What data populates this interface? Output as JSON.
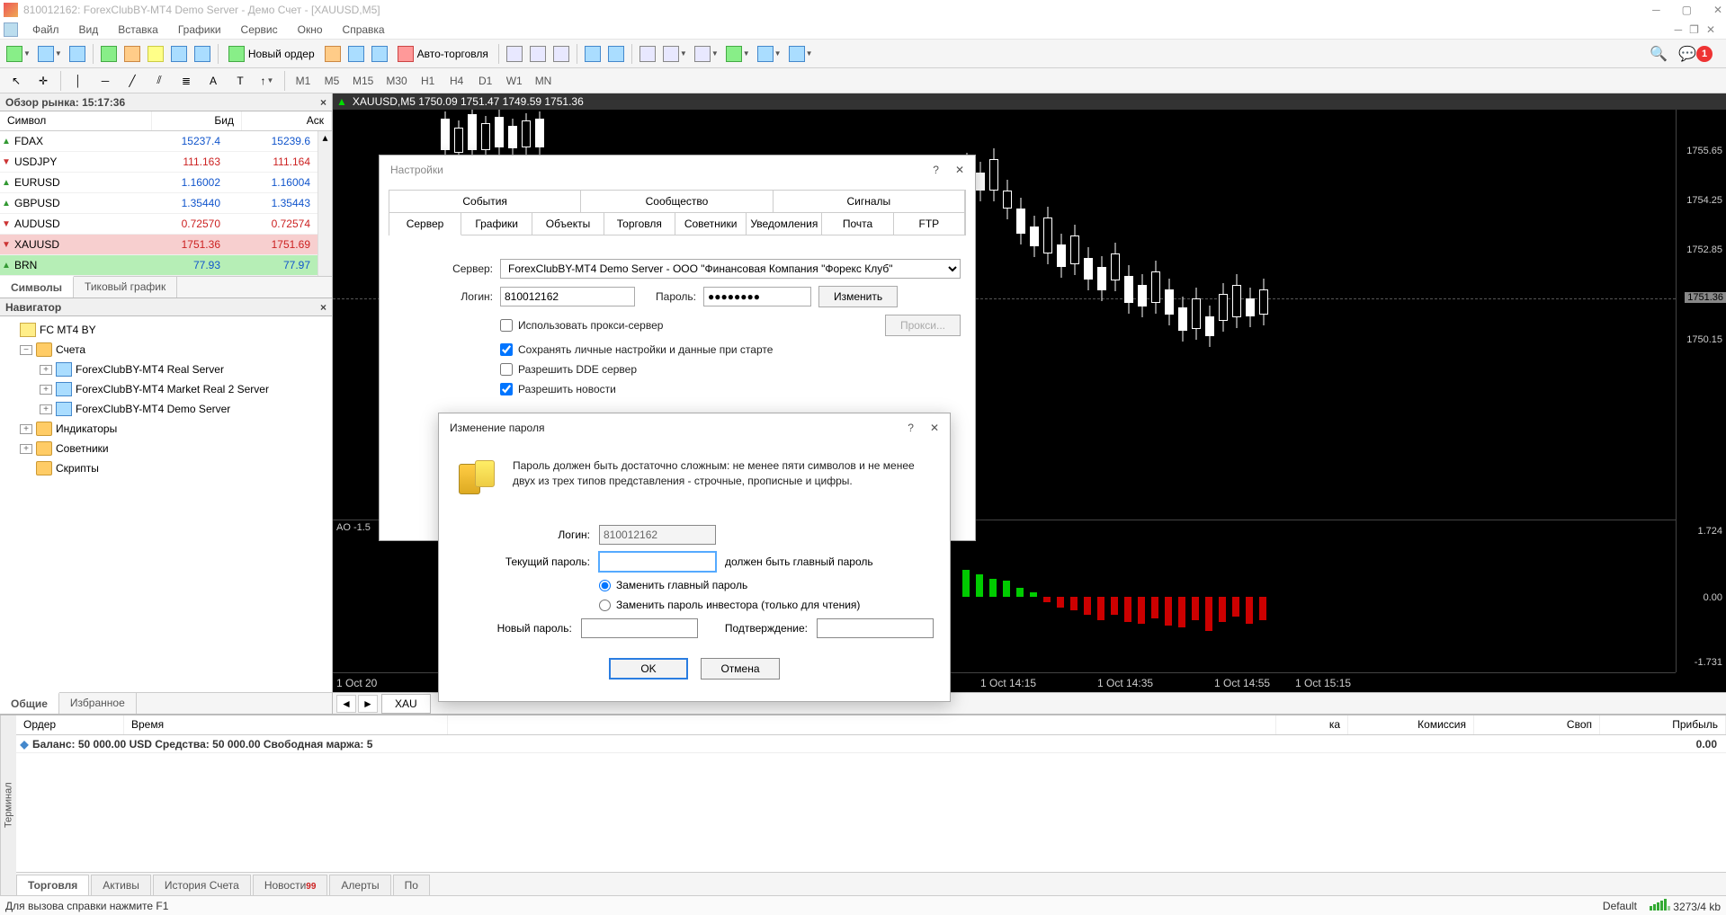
{
  "window": {
    "title": "810012162: ForexClubBY-MT4 Demo Server - Демо Счет - [XAUUSD,M5]"
  },
  "menu": [
    "Файл",
    "Вид",
    "Вставка",
    "Графики",
    "Сервис",
    "Окно",
    "Справка"
  ],
  "toolbar1": {
    "new_order": "Новый ордер",
    "auto_trade": "Авто-торговля",
    "notif_count": "1"
  },
  "timeframes": [
    "M1",
    "M5",
    "M15",
    "M30",
    "H1",
    "H4",
    "D1",
    "W1",
    "MN"
  ],
  "market_watch": {
    "title": "Обзор рынка: 15:17:36",
    "cols": {
      "symbol": "Символ",
      "bid": "Бид",
      "ask": "Аск"
    },
    "rows": [
      {
        "dir": "up",
        "sym": "FDAX",
        "bid": "15237.4",
        "ask": "15239.6",
        "cls": "blue"
      },
      {
        "dir": "down",
        "sym": "USDJPY",
        "bid": "111.163",
        "ask": "111.164",
        "cls": "red"
      },
      {
        "dir": "up",
        "sym": "EURUSD",
        "bid": "1.16002",
        "ask": "1.16004",
        "cls": "blue"
      },
      {
        "dir": "up",
        "sym": "GBPUSD",
        "bid": "1.35440",
        "ask": "1.35443",
        "cls": "blue"
      },
      {
        "dir": "down",
        "sym": "AUDUSD",
        "bid": "0.72570",
        "ask": "0.72574",
        "cls": "red"
      },
      {
        "dir": "down",
        "sym": "XAUUSD",
        "bid": "1751.36",
        "ask": "1751.69",
        "cls": "red",
        "hl": "hl-red"
      },
      {
        "dir": "up",
        "sym": "BRN",
        "bid": "77.93",
        "ask": "77.97",
        "cls": "blue",
        "hl": "hl-green"
      }
    ],
    "tabs": {
      "symbols": "Символы",
      "tick": "Тиковый график"
    }
  },
  "navigator": {
    "title": "Навигатор",
    "root": "FC MT4 BY",
    "accounts": "Счета",
    "servers": [
      "ForexClubBY-MT4 Real Server",
      "ForexClubBY-MT4 Market Real 2 Server",
      "ForexClubBY-MT4 Demo Server"
    ],
    "nodes": [
      "Индикаторы",
      "Советники",
      "Скрипты"
    ],
    "tabs": {
      "common": "Общие",
      "fav": "Избранное"
    }
  },
  "chart": {
    "header": "XAUUSD,M5  1750.09 1751.47 1749.59 1751.36",
    "y_ticks": [
      "1755.65",
      "1754.25",
      "1752.85",
      "1751.36",
      "1750.15"
    ],
    "price_tag": "1751.36",
    "ind_label": "AO -1.5",
    "ind_y": [
      "1.724",
      "0.00",
      "-1.731"
    ],
    "x_ticks": [
      "1 Oct 20",
      "1 Oct 14:15",
      "1 Oct 14:35",
      "1 Oct 14:55",
      "1 Oct 15:15"
    ],
    "tab": "XAU"
  },
  "terminal": {
    "handle": "Терминал",
    "cols": [
      "Ордер",
      "Время",
      "ка",
      "Комиссия",
      "Своп",
      "Прибыль"
    ],
    "balance_line": "Баланс: 50 000.00 USD  Средства: 50 000.00  Свободная маржа: 5",
    "profit": "0.00",
    "tabs": [
      "Торговля",
      "Активы",
      "История Счета",
      "Новости",
      "Алерты",
      "По"
    ],
    "news_badge": "99"
  },
  "statusbar": {
    "help": "Для вызова справки нажмите F1",
    "profile": "Default",
    "conn": "3273/4 kb"
  },
  "dlg_settings": {
    "title": "Настройки",
    "tabs_top": [
      "События",
      "Сообщество",
      "Сигналы"
    ],
    "tabs_bottom": [
      "Сервер",
      "Графики",
      "Объекты",
      "Торговля",
      "Советники",
      "Уведомления",
      "Почта",
      "FTP"
    ],
    "server_label": "Сервер:",
    "server_value": "ForexClubBY-MT4 Demo Server - ООО \"Финансовая Компания \"Форекс Клуб\"",
    "login_label": "Логин:",
    "login_value": "810012162",
    "password_label": "Пароль:",
    "password_mask": "●●●●●●●●",
    "change_btn": "Изменить",
    "proxy_chk": "Использовать прокси-сервер",
    "proxy_btn": "Прокси...",
    "keep_chk": "Сохранять личные настройки и данные при старте",
    "dde_chk": "Разрешить DDE сервер",
    "news_chk": "Разрешить новости"
  },
  "dlg_pwd": {
    "title": "Изменение пароля",
    "info": "Пароль должен быть достаточно сложным: не менее пяти символов и не менее двух из трех типов представления - строчные, прописные и цифры.",
    "login_label": "Логин:",
    "login_value": "810012162",
    "cur_label": "Текущий пароль:",
    "cur_hint": "должен быть главный пароль",
    "radio1": "Заменить главный пароль",
    "radio2": "Заменить пароль инвестора (только для чтения)",
    "new_label": "Новый пароль:",
    "confirm_label": "Подтверждение:",
    "ok": "OK",
    "cancel": "Отмена"
  }
}
